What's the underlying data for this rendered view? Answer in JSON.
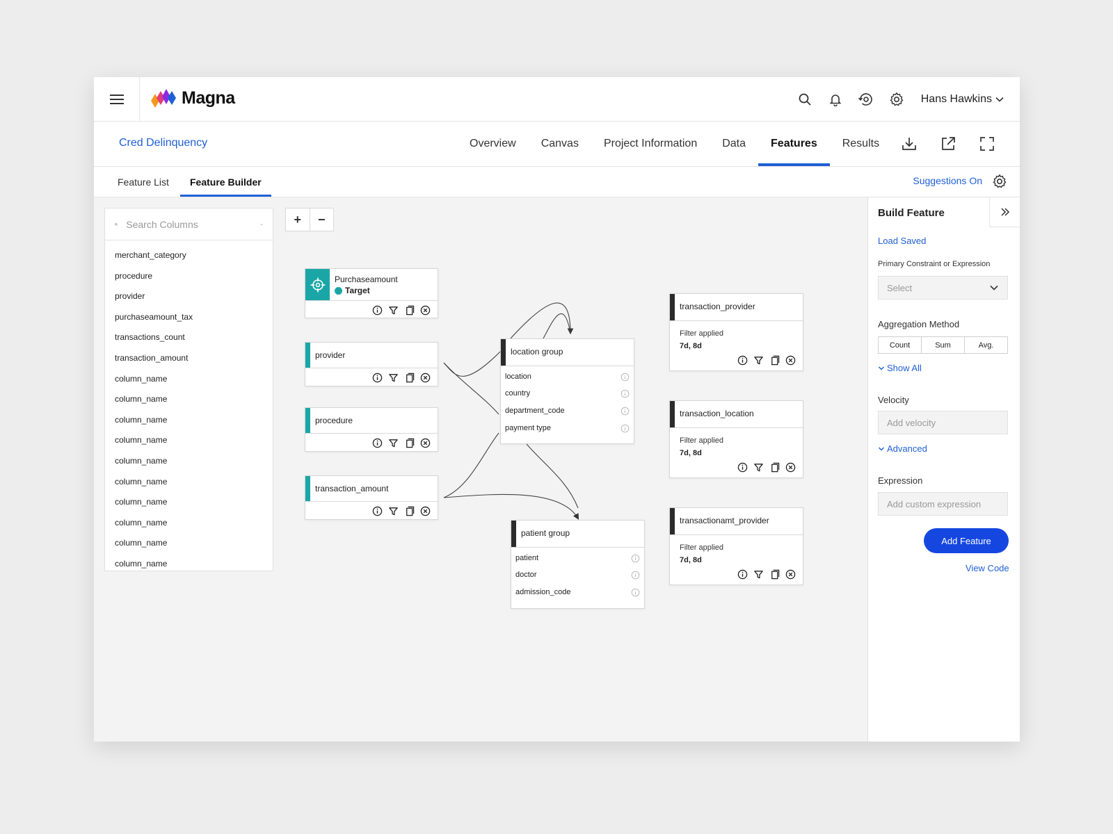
{
  "app": {
    "brand": "Magna",
    "user_name": "Hans Hawkins"
  },
  "project": {
    "name": "Cred Delinquency",
    "nav_tabs": [
      "Overview",
      "Canvas",
      "Project Information",
      "Data",
      "Features",
      "Results"
    ],
    "active_tab": "Features"
  },
  "subtabs": {
    "items": [
      "Feature List",
      "Feature Builder"
    ],
    "active": "Feature Builder",
    "suggestions_label": "Suggestions On"
  },
  "columns": {
    "search_placeholder": "Search Columns",
    "items": [
      "merchant_category",
      "procedure",
      "provider",
      "purchaseamount_tax",
      "transactions_count",
      "transaction_amount",
      "column_name",
      "column_name",
      "column_name",
      "column_name",
      "column_name",
      "column_name",
      "column_name",
      "column_name",
      "column_name",
      "column_name"
    ]
  },
  "zoom": {
    "in": "+",
    "out": "−"
  },
  "canvas": {
    "target_node": {
      "title": "Purchaseamount",
      "badge": "Target"
    },
    "column_nodes": [
      {
        "title": "provider"
      },
      {
        "title": "procedure"
      },
      {
        "title": "transaction_amount"
      }
    ],
    "location_group": {
      "title": "location group",
      "rows": [
        "location",
        "country",
        "department_code",
        "payment type"
      ]
    },
    "patient_group": {
      "title": "patient group",
      "rows": [
        "patient",
        "doctor",
        "admission_code"
      ]
    },
    "feature_nodes": [
      {
        "title": "transaction_provider",
        "filter_label": "Filter applied",
        "filter_value": "7d, 8d"
      },
      {
        "title": "transaction_location",
        "filter_label": "Filter applied",
        "filter_value": "7d, 8d"
      },
      {
        "title": "transactionamt_provider",
        "filter_label": "Filter applied",
        "filter_value": "7d, 8d"
      }
    ]
  },
  "build_panel": {
    "title": "Build Feature",
    "load_saved": "Load Saved",
    "primary_label": "Primary Constraint or Expression",
    "primary_placeholder": "Select",
    "aggregation_label": "Aggregation Method",
    "aggregation_options": [
      "Count",
      "Sum",
      "Avg."
    ],
    "show_all": "Show All",
    "velocity_label": "Velocity",
    "velocity_placeholder": "Add velocity",
    "advanced": "Advanced",
    "expression_label": "Expression",
    "expression_placeholder": "Add custom expression",
    "add_button": "Add Feature",
    "view_code": "View Code"
  },
  "colors": {
    "accent": "#1f5fd6",
    "button": "#1547e0",
    "teal": "#1aa6a6",
    "dark_bar": "#2b2b2b"
  }
}
